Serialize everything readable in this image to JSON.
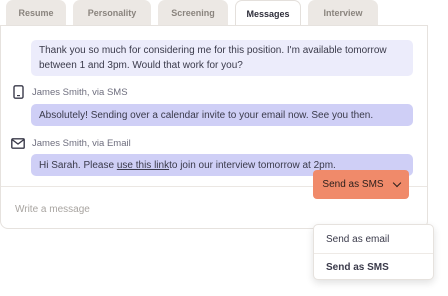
{
  "tabs": [
    {
      "label": "Resume",
      "active": false
    },
    {
      "label": "Personality",
      "active": false
    },
    {
      "label": "Screening",
      "active": false
    },
    {
      "label": "Messages",
      "active": true
    },
    {
      "label": "Interview",
      "active": false
    }
  ],
  "messages": [
    {
      "text": "Thank you so much for considering me for this position. I'm available tomorrow between 1 and 3pm. Would that work for you?"
    },
    {
      "sender": "James Smith, via SMS",
      "channel_icon": "phone-icon",
      "text": "Absolutely! Sending over a calendar invite to your email now. See you then."
    },
    {
      "sender": "James Smith, via Email",
      "channel_icon": "envelope-icon",
      "text_before": "Hi Sarah. Please ",
      "link_text": "use this link",
      "text_after": " to join our interview tomorrow at 2pm."
    }
  ],
  "compose": {
    "placeholder": "Write a message"
  },
  "send_button": {
    "label": "Send as SMS",
    "icon": "chevron-down-icon",
    "color": "#f08a6a"
  },
  "send_options": [
    {
      "label": "Send as email",
      "selected": false
    },
    {
      "label": "Send as SMS",
      "selected": true
    }
  ],
  "colors": {
    "bubble_incoming": "#ececfb",
    "bubble_outgoing": "#cfcff6",
    "accent": "#f08a6a"
  }
}
